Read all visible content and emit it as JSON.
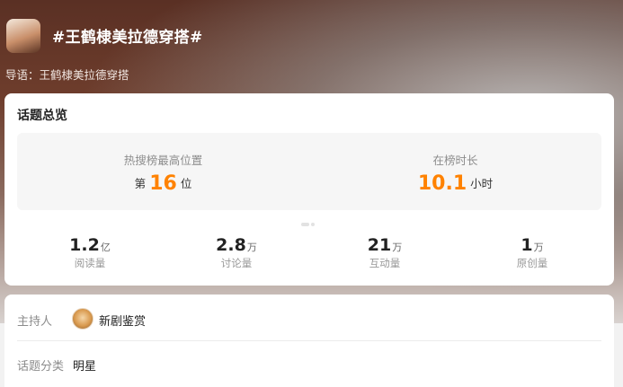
{
  "header": {
    "title": "#王鹤棣美拉德穿搭#",
    "guide": "导语：王鹤棣美拉德穿搭"
  },
  "overview": {
    "title": "话题总览",
    "highest_rank": {
      "label": "热搜榜最高位置",
      "prefix": "第",
      "value": "16",
      "suffix": "位"
    },
    "duration": {
      "label": "在榜时长",
      "value": "10.1",
      "unit": "小时"
    },
    "stats": [
      {
        "value": "1.2",
        "unit": "亿",
        "label": "阅读量"
      },
      {
        "value": "2.8",
        "unit": "万",
        "label": "讨论量"
      },
      {
        "value": "21",
        "unit": "万",
        "label": "互动量"
      },
      {
        "value": "1",
        "unit": "万",
        "label": "原创量"
      }
    ]
  },
  "info": {
    "host_label": "主持人",
    "host_name": "新剧鉴赏",
    "category_label": "话题分类",
    "category_value": "明星"
  },
  "colors": {
    "accent": "#ff8200",
    "banner_brown": "#6e3d2c"
  }
}
